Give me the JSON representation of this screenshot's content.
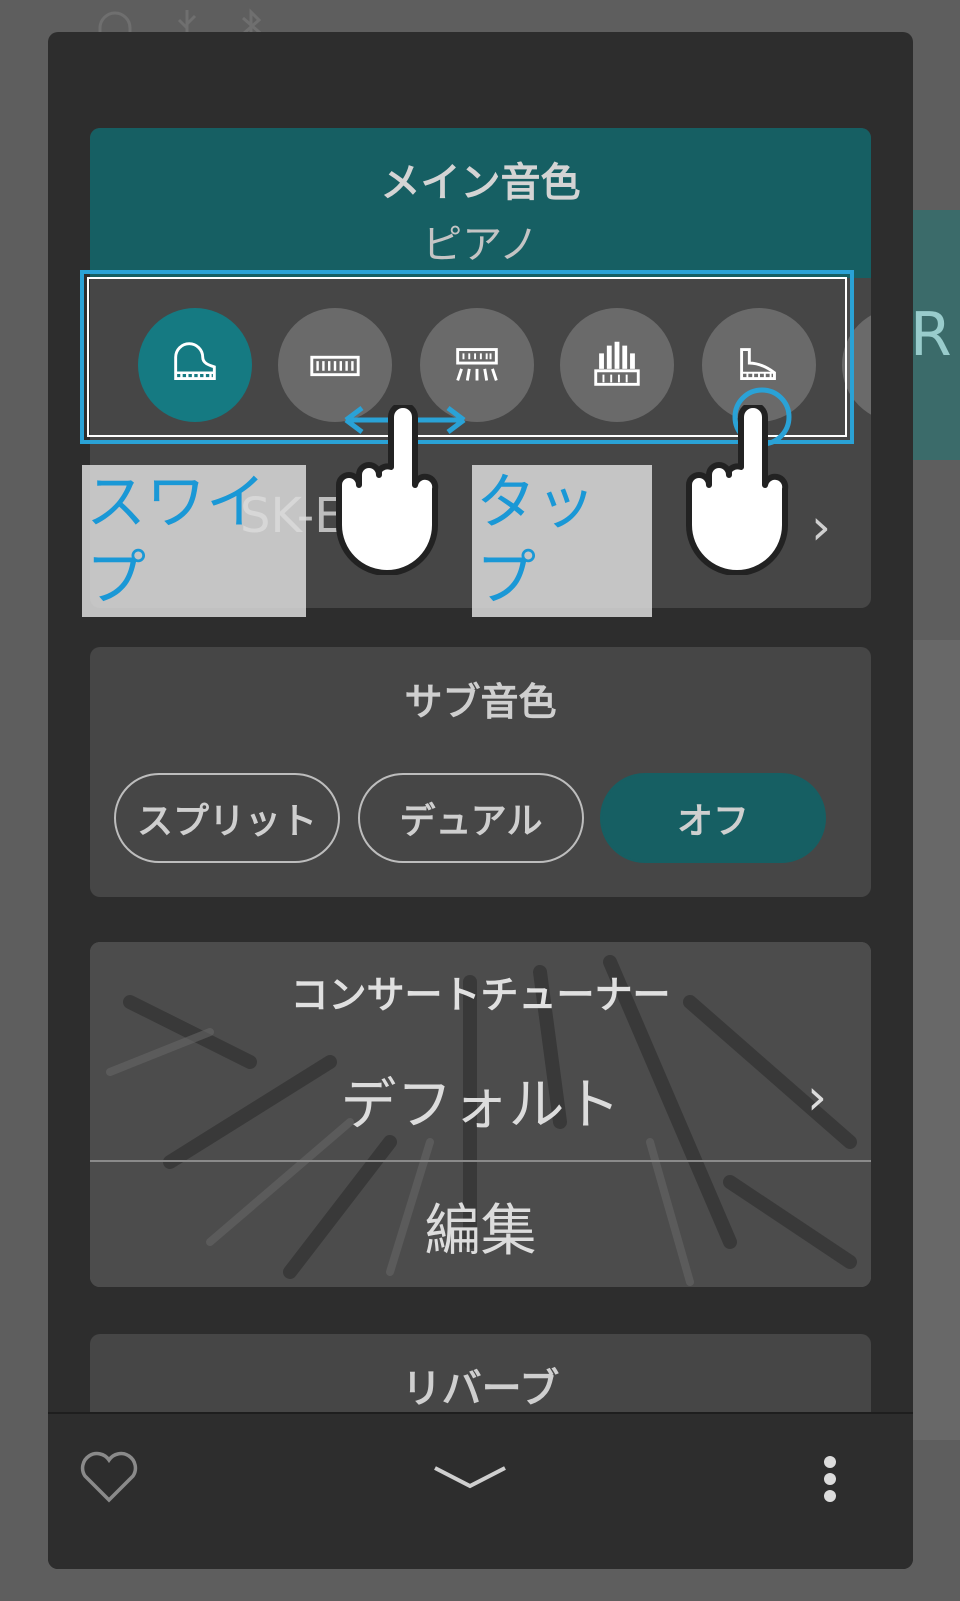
{
  "background": {
    "status_icons": [
      "headphones-icon",
      "usb-icon",
      "bluetooth-icon"
    ],
    "right_letter": "R"
  },
  "main_voice": {
    "title": "メイン音色",
    "value": "ピアノ",
    "icons": [
      "grand-piano-icon",
      "electric-piano-icon",
      "harpsichord-icon",
      "organ-icon",
      "upright-piano-icon"
    ],
    "model_name": "SK-E",
    "chevron": "›"
  },
  "gesture": {
    "swipe_label": "スワイプ",
    "tap_label": "タップ"
  },
  "sub_voice": {
    "title": "サブ音色",
    "options": [
      "スプリット",
      "デュアル",
      "オフ"
    ],
    "selected": "オフ"
  },
  "tuner": {
    "title": "コンサートチューナー",
    "value": "デフォルト",
    "edit": "編集",
    "chevron": "›"
  },
  "reverb": {
    "title": "リバーブ"
  },
  "bottom_bar": {
    "icons": [
      "heart-icon",
      "chevron-down-icon",
      "more-vertical-icon"
    ]
  },
  "colors": {
    "accent_teal": "#165f63",
    "active_circle": "#157a82",
    "highlight_blue": "#2aa2d6"
  }
}
